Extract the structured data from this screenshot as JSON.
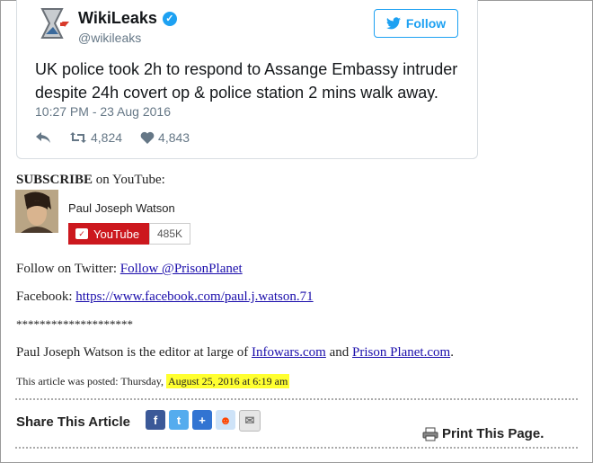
{
  "tweet": {
    "name": "WikiLeaks",
    "handle": "@wikileaks",
    "follow_label": "Follow",
    "text": "UK police took 2h to respond to Assange Embassy intruder despite 24h covert op & police station 2 mins walk away.",
    "date": "10:27 PM - 23 Aug 2016",
    "retweets": "4,824",
    "likes": "4,843"
  },
  "subscribe": {
    "bold": "SUBSCRIBE",
    "rest": " on YouTube:"
  },
  "youtube": {
    "channel_name": "Paul Joseph Watson",
    "button_label": "YouTube",
    "subscriber_count": "485K"
  },
  "social": {
    "twitter_prefix": "Follow on Twitter: ",
    "twitter_link": "Follow @PrisonPlanet",
    "facebook_prefix": "Facebook: ",
    "facebook_link": "https://www.facebook.com/paul.j.watson.71",
    "separator": "********************"
  },
  "bio": {
    "prefix": "Paul Joseph Watson is the editor at large of ",
    "link1": "Infowars.com",
    "middle": " and ",
    "link2": "Prison Planet.com",
    "suffix": "."
  },
  "posted": {
    "prefix": "This article was posted: Thursday, ",
    "date": "August 25, 2016 at 6:19 am"
  },
  "share": {
    "title": "Share This Article",
    "icons": [
      "facebook-icon",
      "twitter-icon",
      "delicious-icon",
      "reddit-icon",
      "email-icon"
    ],
    "print_label": "Print This Page."
  },
  "colors": {
    "twitter_blue": "#1da1f2",
    "youtube_red": "#cc181e",
    "highlight": "#ffff30",
    "link": "#1a0dab"
  }
}
